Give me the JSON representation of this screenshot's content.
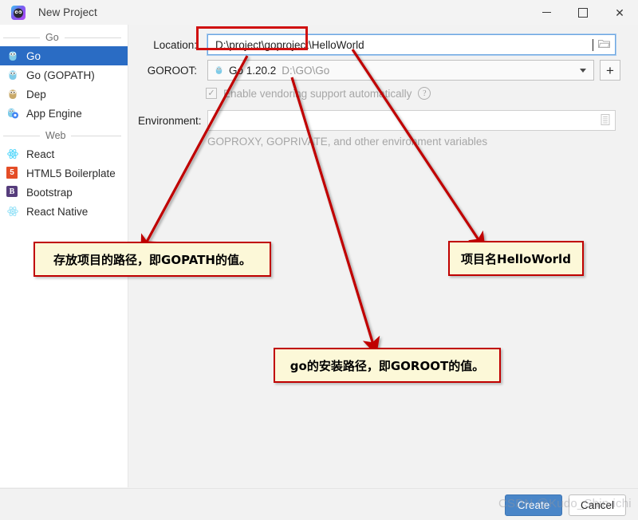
{
  "window": {
    "title": "New Project",
    "app_icon": "goland-icon",
    "controls": {
      "minimize": "minimize-icon",
      "maximize": "maximize-icon",
      "close": "close-icon"
    }
  },
  "sidebar": {
    "groups": [
      {
        "label": "Go",
        "items": [
          {
            "label": "Go",
            "icon": "gopher-icon",
            "selected": true
          },
          {
            "label": "Go (GOPATH)",
            "icon": "gopher-icon",
            "selected": false
          },
          {
            "label": "Dep",
            "icon": "dep-gopher-icon",
            "selected": false
          },
          {
            "label": "App Engine",
            "icon": "app-engine-icon",
            "selected": false
          }
        ]
      },
      {
        "label": "Web",
        "items": [
          {
            "label": "React",
            "icon": "react-icon",
            "selected": false
          },
          {
            "label": "HTML5 Boilerplate",
            "icon": "html5-icon",
            "selected": false
          },
          {
            "label": "Bootstrap",
            "icon": "bootstrap-icon",
            "selected": false
          },
          {
            "label": "React Native",
            "icon": "react-icon",
            "selected": false
          }
        ]
      }
    ]
  },
  "form": {
    "location": {
      "label": "Location:",
      "value": "D:\\project\\goproject\\HelloWorld",
      "browse_icon": "folder-icon"
    },
    "goroot": {
      "label": "GOROOT:",
      "sdk_icon": "gopher-icon",
      "sdk_name": "Go 1.20.2",
      "sdk_path": "D:\\GO\\Go",
      "dropdown_icon": "chevron-down-icon",
      "add_label": "+"
    },
    "vendoring": {
      "label": "Enable vendoring support automatically",
      "checked": true,
      "check_glyph": "✓",
      "help_icon": "help-icon",
      "help_glyph": "?"
    },
    "environment": {
      "label": "Environment:",
      "value": "",
      "editor_icon": "list-editor-icon",
      "hint": "GOPROXY, GOPRIVATE, and other environment variables"
    }
  },
  "footer": {
    "create_label": "Create",
    "cancel_label": "Cancel"
  },
  "annotations": {
    "accent_color": "#c00000",
    "fill_color": "#fcf8d8",
    "boxes": [
      {
        "text": "存放项目的路径，即GOPATH的值。",
        "name": "annotation-gopath"
      },
      {
        "text": "go的安装路径，即GOROOT的值。",
        "name": "annotation-goroot"
      },
      {
        "text": "项目名HelloWorld",
        "name": "annotation-project-name"
      }
    ],
    "highlight": {
      "name": "location-path-highlight"
    }
  },
  "watermark": {
    "text": "CSDN @Kudo_Shin-ichi"
  }
}
